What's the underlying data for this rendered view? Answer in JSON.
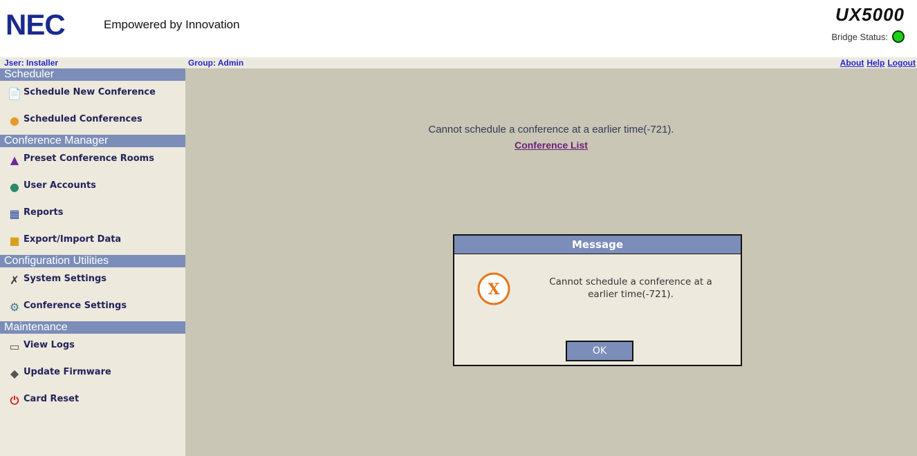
{
  "header": {
    "brand": "NEC",
    "tagline": "Empowered by Innovation",
    "product": "UX5000",
    "bridge_label": "Bridge Status:",
    "bridge_color": "#19d119"
  },
  "userbar": {
    "user": "Jser: Installer",
    "group": "Group: Admin",
    "links": [
      "About",
      "Help",
      "Logout"
    ]
  },
  "sidebar": {
    "sections": [
      {
        "title": "Scheduler",
        "items": [
          {
            "label": "Schedule New Conference",
            "icon": "schedule-icon"
          },
          {
            "label": "Scheduled Conferences",
            "icon": "people-icon"
          }
        ]
      },
      {
        "title": "Conference Manager",
        "items": [
          {
            "label": "Preset Conference Rooms",
            "icon": "rooms-icon"
          },
          {
            "label": "User Accounts",
            "icon": "users-icon"
          },
          {
            "label": "Reports",
            "icon": "calendar-icon"
          },
          {
            "label": "Export/Import Data",
            "icon": "export-icon"
          }
        ]
      },
      {
        "title": "Configuration Utilities",
        "items": [
          {
            "label": "System Settings",
            "icon": "tools-icon"
          },
          {
            "label": "Conference Settings",
            "icon": "settings-icon"
          }
        ]
      },
      {
        "title": "Maintenance",
        "items": [
          {
            "label": "View Logs",
            "icon": "logs-icon"
          },
          {
            "label": "Update Firmware",
            "icon": "firmware-icon"
          },
          {
            "label": "Card Reset",
            "icon": "power-icon"
          }
        ]
      }
    ]
  },
  "main": {
    "error_text": "Cannot schedule a conference at a earlier time(-721).",
    "link_text": "Conference List"
  },
  "dialog": {
    "title": "Message",
    "icon_glyph": "X",
    "message_line1": "Cannot schedule a conference at a",
    "message_line2": "earlier time(-721).",
    "ok_label": "OK"
  }
}
